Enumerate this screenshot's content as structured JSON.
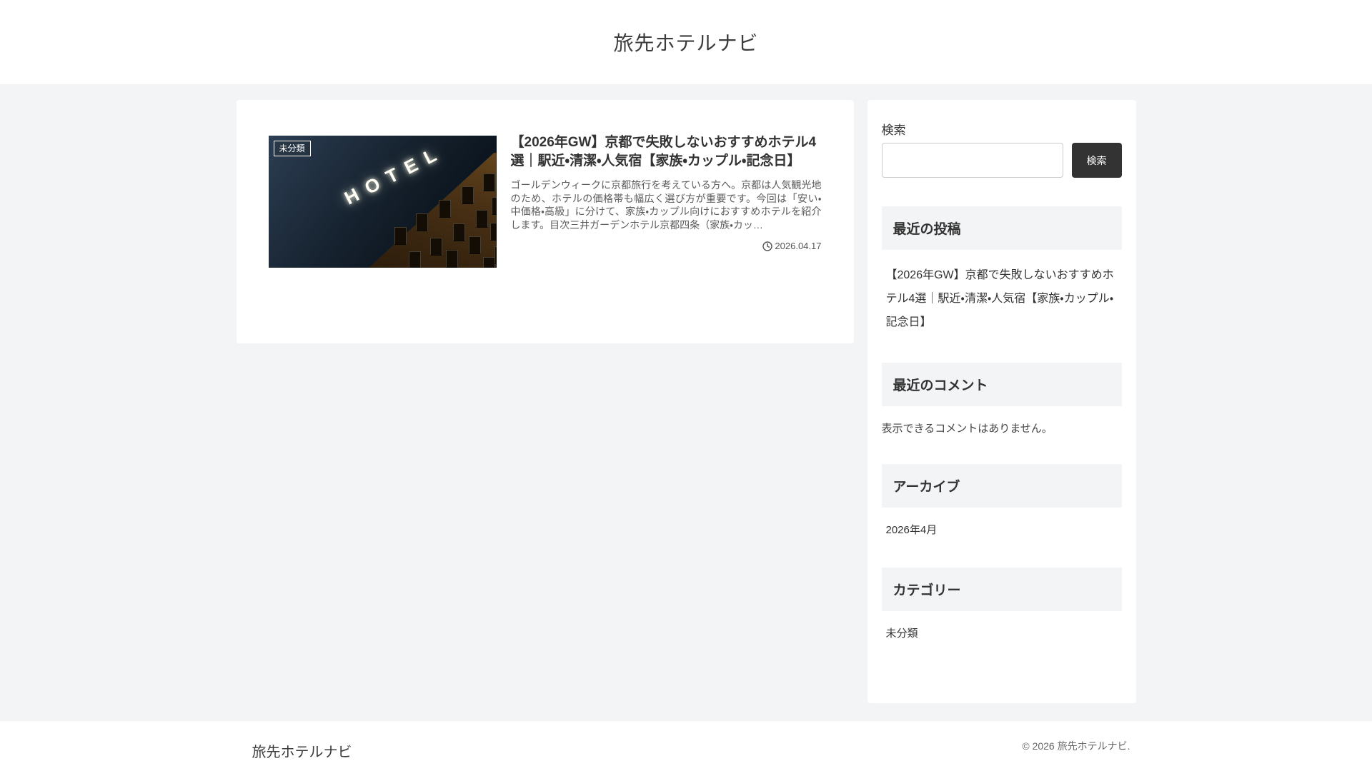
{
  "header": {
    "site_title": "旅先ホテルナビ"
  },
  "article": {
    "category_badge": "未分類",
    "thumbnail": {
      "sign_text": "HOTEL"
    },
    "title": "【2026年GW】京都で失敗しないおすすめホテル4選｜駅近・清潔・人気宿【家族・カップル・記念日】",
    "excerpt": "ゴールデンウィークに京都旅行を考えている方へ。京都は人気観光地のため、ホテルの価格帯も幅広く選び方が重要です。今回は「安い・中価格・高級」に分けて、家族・カップル向けにおすすめホテルを紹介します。目次三井ガーデンホテル京都四条（家族・カッ…",
    "date": "2026.04.17"
  },
  "sidebar": {
    "search": {
      "label": "検索",
      "button_label": "検索",
      "value": "",
      "placeholder": ""
    },
    "recent_posts": {
      "heading": "最近の投稿",
      "items": [
        "【2026年GW】京都で失敗しないおすすめホテル4選｜駅近・清潔・人気宿【家族・カップル・記念日】"
      ]
    },
    "recent_comments": {
      "heading": "最近のコメント",
      "empty_message": "表示できるコメントはありません。"
    },
    "archive": {
      "heading": "アーカイブ",
      "items": [
        "2026年4月"
      ]
    },
    "categories": {
      "heading": "カテゴリー",
      "items": [
        "未分類"
      ]
    }
  },
  "footer": {
    "site_name": "旅先ホテルナビ",
    "copyright": "© 2026 旅先ホテルナビ."
  },
  "colors": {
    "page_background": "#f3f4f5",
    "card_background": "#ffffff",
    "accent_button": "#333333",
    "heading_band": "#f3f4f6",
    "text_primary": "#333333",
    "text_secondary": "#5b5b5b"
  }
}
